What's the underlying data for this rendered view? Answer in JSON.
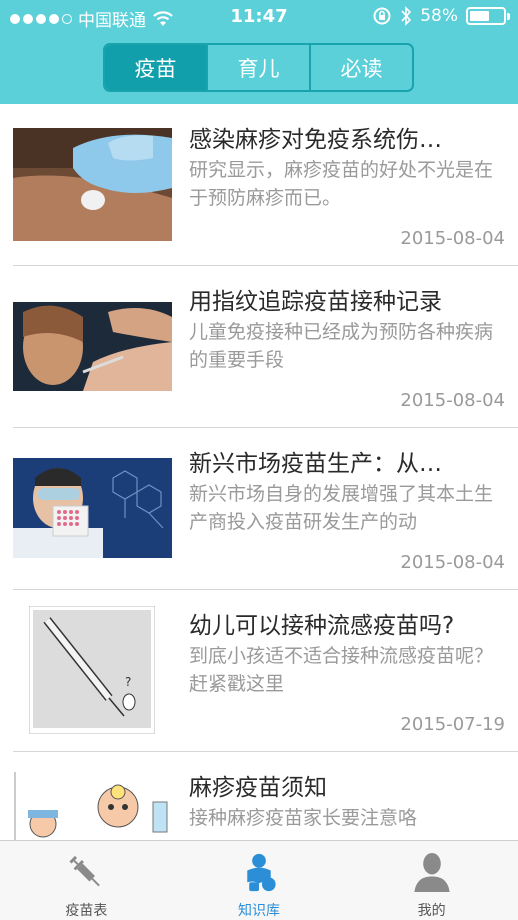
{
  "status": {
    "carrier": "中国联通",
    "time": "11:47",
    "battery_pct_text": "58%",
    "battery_level": 0.58
  },
  "tabs": [
    {
      "label": "疫苗",
      "active": true
    },
    {
      "label": "育儿",
      "active": false
    },
    {
      "label": "必读",
      "active": false
    }
  ],
  "articles": [
    {
      "title": "感染麻疹对免疫系统伤…",
      "summary": "研究显示，麻疹疫苗的好处不光是在于预防麻疹而已。",
      "date": "2015-08-04",
      "image": "glove-bandage-arm"
    },
    {
      "title": "用指纹追踪疫苗接种记录",
      "summary": "儿童免疫接种已经成为预防各种疾病的重要手段",
      "date": "2015-08-04",
      "image": "child-injection"
    },
    {
      "title": "新兴市场疫苗生产：从…",
      "summary": "新兴市场自身的发展增强了其本土生产商投入疫苗研发生产的动",
      "date": "2015-08-04",
      "image": "lab-scientist"
    },
    {
      "title": "幼儿可以接种流感疫苗吗?",
      "summary": "到底小孩适不适合接种流感疫苗呢？赶紧戳这里",
      "date": "2015-07-19",
      "image": "syringe-cartoon"
    },
    {
      "title": "麻疹疫苗须知",
      "summary": "接种麻疹疫苗家长要注意咯",
      "date": "",
      "image": "doctor-cartoon"
    }
  ],
  "tabbar": [
    {
      "label": "疫苗表",
      "icon": "syringe-icon",
      "active": false
    },
    {
      "label": "知识库",
      "icon": "knowledge-icon",
      "active": true
    },
    {
      "label": "我的",
      "icon": "user-icon",
      "active": false
    }
  ],
  "colors": {
    "header": "#5bd0d9",
    "tab_active": "#11a0ab",
    "tab_border": "#19a3ad",
    "tabbar_active": "#2b8ed6"
  }
}
